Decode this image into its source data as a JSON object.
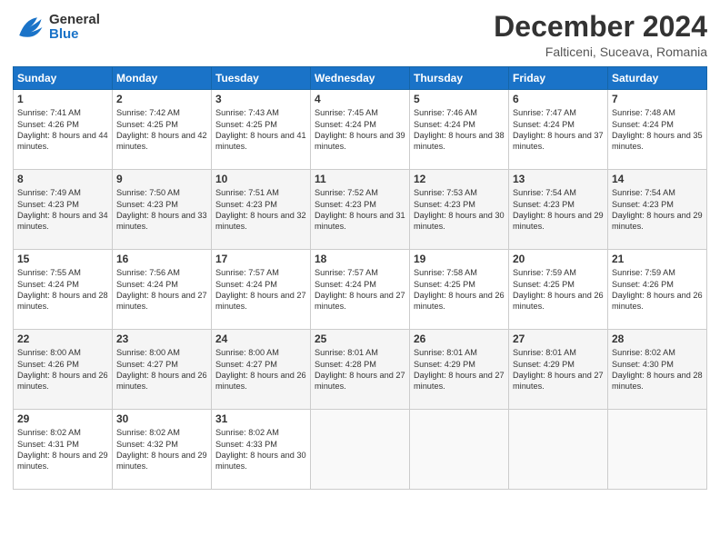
{
  "header": {
    "logo_general": "General",
    "logo_blue": "Blue",
    "main_title": "December 2024",
    "subtitle": "Falticeni, Suceava, Romania"
  },
  "calendar": {
    "days_of_week": [
      "Sunday",
      "Monday",
      "Tuesday",
      "Wednesday",
      "Thursday",
      "Friday",
      "Saturday"
    ],
    "weeks": [
      [
        {
          "day": "1",
          "sunrise": "Sunrise: 7:41 AM",
          "sunset": "Sunset: 4:26 PM",
          "daylight": "Daylight: 8 hours and 44 minutes."
        },
        {
          "day": "2",
          "sunrise": "Sunrise: 7:42 AM",
          "sunset": "Sunset: 4:25 PM",
          "daylight": "Daylight: 8 hours and 42 minutes."
        },
        {
          "day": "3",
          "sunrise": "Sunrise: 7:43 AM",
          "sunset": "Sunset: 4:25 PM",
          "daylight": "Daylight: 8 hours and 41 minutes."
        },
        {
          "day": "4",
          "sunrise": "Sunrise: 7:45 AM",
          "sunset": "Sunset: 4:24 PM",
          "daylight": "Daylight: 8 hours and 39 minutes."
        },
        {
          "day": "5",
          "sunrise": "Sunrise: 7:46 AM",
          "sunset": "Sunset: 4:24 PM",
          "daylight": "Daylight: 8 hours and 38 minutes."
        },
        {
          "day": "6",
          "sunrise": "Sunrise: 7:47 AM",
          "sunset": "Sunset: 4:24 PM",
          "daylight": "Daylight: 8 hours and 37 minutes."
        },
        {
          "day": "7",
          "sunrise": "Sunrise: 7:48 AM",
          "sunset": "Sunset: 4:24 PM",
          "daylight": "Daylight: 8 hours and 35 minutes."
        }
      ],
      [
        {
          "day": "8",
          "sunrise": "Sunrise: 7:49 AM",
          "sunset": "Sunset: 4:23 PM",
          "daylight": "Daylight: 8 hours and 34 minutes."
        },
        {
          "day": "9",
          "sunrise": "Sunrise: 7:50 AM",
          "sunset": "Sunset: 4:23 PM",
          "daylight": "Daylight: 8 hours and 33 minutes."
        },
        {
          "day": "10",
          "sunrise": "Sunrise: 7:51 AM",
          "sunset": "Sunset: 4:23 PM",
          "daylight": "Daylight: 8 hours and 32 minutes."
        },
        {
          "day": "11",
          "sunrise": "Sunrise: 7:52 AM",
          "sunset": "Sunset: 4:23 PM",
          "daylight": "Daylight: 8 hours and 31 minutes."
        },
        {
          "day": "12",
          "sunrise": "Sunrise: 7:53 AM",
          "sunset": "Sunset: 4:23 PM",
          "daylight": "Daylight: 8 hours and 30 minutes."
        },
        {
          "day": "13",
          "sunrise": "Sunrise: 7:54 AM",
          "sunset": "Sunset: 4:23 PM",
          "daylight": "Daylight: 8 hours and 29 minutes."
        },
        {
          "day": "14",
          "sunrise": "Sunrise: 7:54 AM",
          "sunset": "Sunset: 4:23 PM",
          "daylight": "Daylight: 8 hours and 29 minutes."
        }
      ],
      [
        {
          "day": "15",
          "sunrise": "Sunrise: 7:55 AM",
          "sunset": "Sunset: 4:24 PM",
          "daylight": "Daylight: 8 hours and 28 minutes."
        },
        {
          "day": "16",
          "sunrise": "Sunrise: 7:56 AM",
          "sunset": "Sunset: 4:24 PM",
          "daylight": "Daylight: 8 hours and 27 minutes."
        },
        {
          "day": "17",
          "sunrise": "Sunrise: 7:57 AM",
          "sunset": "Sunset: 4:24 PM",
          "daylight": "Daylight: 8 hours and 27 minutes."
        },
        {
          "day": "18",
          "sunrise": "Sunrise: 7:57 AM",
          "sunset": "Sunset: 4:24 PM",
          "daylight": "Daylight: 8 hours and 27 minutes."
        },
        {
          "day": "19",
          "sunrise": "Sunrise: 7:58 AM",
          "sunset": "Sunset: 4:25 PM",
          "daylight": "Daylight: 8 hours and 26 minutes."
        },
        {
          "day": "20",
          "sunrise": "Sunrise: 7:59 AM",
          "sunset": "Sunset: 4:25 PM",
          "daylight": "Daylight: 8 hours and 26 minutes."
        },
        {
          "day": "21",
          "sunrise": "Sunrise: 7:59 AM",
          "sunset": "Sunset: 4:26 PM",
          "daylight": "Daylight: 8 hours and 26 minutes."
        }
      ],
      [
        {
          "day": "22",
          "sunrise": "Sunrise: 8:00 AM",
          "sunset": "Sunset: 4:26 PM",
          "daylight": "Daylight: 8 hours and 26 minutes."
        },
        {
          "day": "23",
          "sunrise": "Sunrise: 8:00 AM",
          "sunset": "Sunset: 4:27 PM",
          "daylight": "Daylight: 8 hours and 26 minutes."
        },
        {
          "day": "24",
          "sunrise": "Sunrise: 8:00 AM",
          "sunset": "Sunset: 4:27 PM",
          "daylight": "Daylight: 8 hours and 26 minutes."
        },
        {
          "day": "25",
          "sunrise": "Sunrise: 8:01 AM",
          "sunset": "Sunset: 4:28 PM",
          "daylight": "Daylight: 8 hours and 27 minutes."
        },
        {
          "day": "26",
          "sunrise": "Sunrise: 8:01 AM",
          "sunset": "Sunset: 4:29 PM",
          "daylight": "Daylight: 8 hours and 27 minutes."
        },
        {
          "day": "27",
          "sunrise": "Sunrise: 8:01 AM",
          "sunset": "Sunset: 4:29 PM",
          "daylight": "Daylight: 8 hours and 27 minutes."
        },
        {
          "day": "28",
          "sunrise": "Sunrise: 8:02 AM",
          "sunset": "Sunset: 4:30 PM",
          "daylight": "Daylight: 8 hours and 28 minutes."
        }
      ],
      [
        {
          "day": "29",
          "sunrise": "Sunrise: 8:02 AM",
          "sunset": "Sunset: 4:31 PM",
          "daylight": "Daylight: 8 hours and 29 minutes."
        },
        {
          "day": "30",
          "sunrise": "Sunrise: 8:02 AM",
          "sunset": "Sunset: 4:32 PM",
          "daylight": "Daylight: 8 hours and 29 minutes."
        },
        {
          "day": "31",
          "sunrise": "Sunrise: 8:02 AM",
          "sunset": "Sunset: 4:33 PM",
          "daylight": "Daylight: 8 hours and 30 minutes."
        },
        null,
        null,
        null,
        null
      ]
    ]
  }
}
